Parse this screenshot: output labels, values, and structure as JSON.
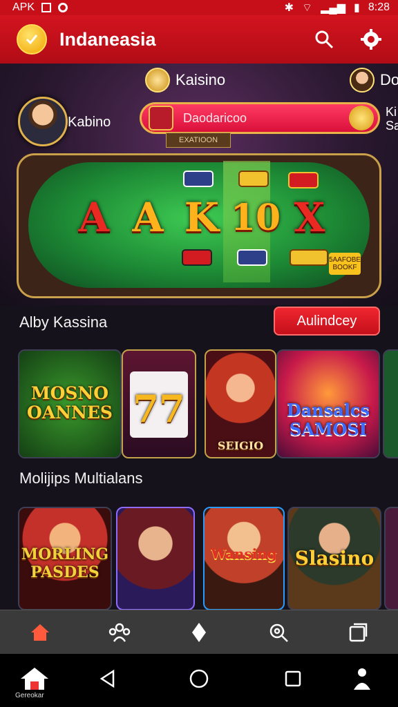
{
  "status_bar": {
    "left_text": "APK",
    "time": "8:28"
  },
  "app_bar": {
    "title": "Indaneasia",
    "logo_icon": "coin-check-icon",
    "search_icon": "search-icon",
    "settings_icon": "gear-icon"
  },
  "hero": {
    "tab_center": "Kaisino",
    "tab_right": "Do",
    "avatar_label": "Kabino",
    "search_text": "Daodaricoo",
    "edge_text_1": "Ki",
    "edge_text_2": "Sa",
    "plaque_text": "EXATIOON",
    "reel_symbols": [
      "A",
      "A",
      "K",
      "10",
      "X"
    ],
    "table_tag": "5AAFOBE BOOKF"
  },
  "section1": {
    "title": "Alby Kassina",
    "button_label": "Aulindcey"
  },
  "cards_row1": [
    {
      "text": "MOSNO OANNES"
    },
    {
      "text": "77"
    },
    {
      "text": "SEIGIO"
    },
    {
      "text": "Dansalcs SAMOSI"
    }
  ],
  "section2": {
    "title": "Molijips Multialans"
  },
  "cards_row2": [
    {
      "text": "MORLING PASDES"
    },
    {
      "text": ""
    },
    {
      "text": "Wansing"
    },
    {
      "text": "Slasino"
    }
  ],
  "bottom_nav": [
    "home-icon",
    "community-icon",
    "diamond-icon",
    "search-gear-icon",
    "copy-icon"
  ],
  "system_nav": {
    "home_label": "Gereokar"
  },
  "colors": {
    "brand_red": "#c70f1a",
    "gold": "#e9b349",
    "dark_bg": "#15121b"
  }
}
